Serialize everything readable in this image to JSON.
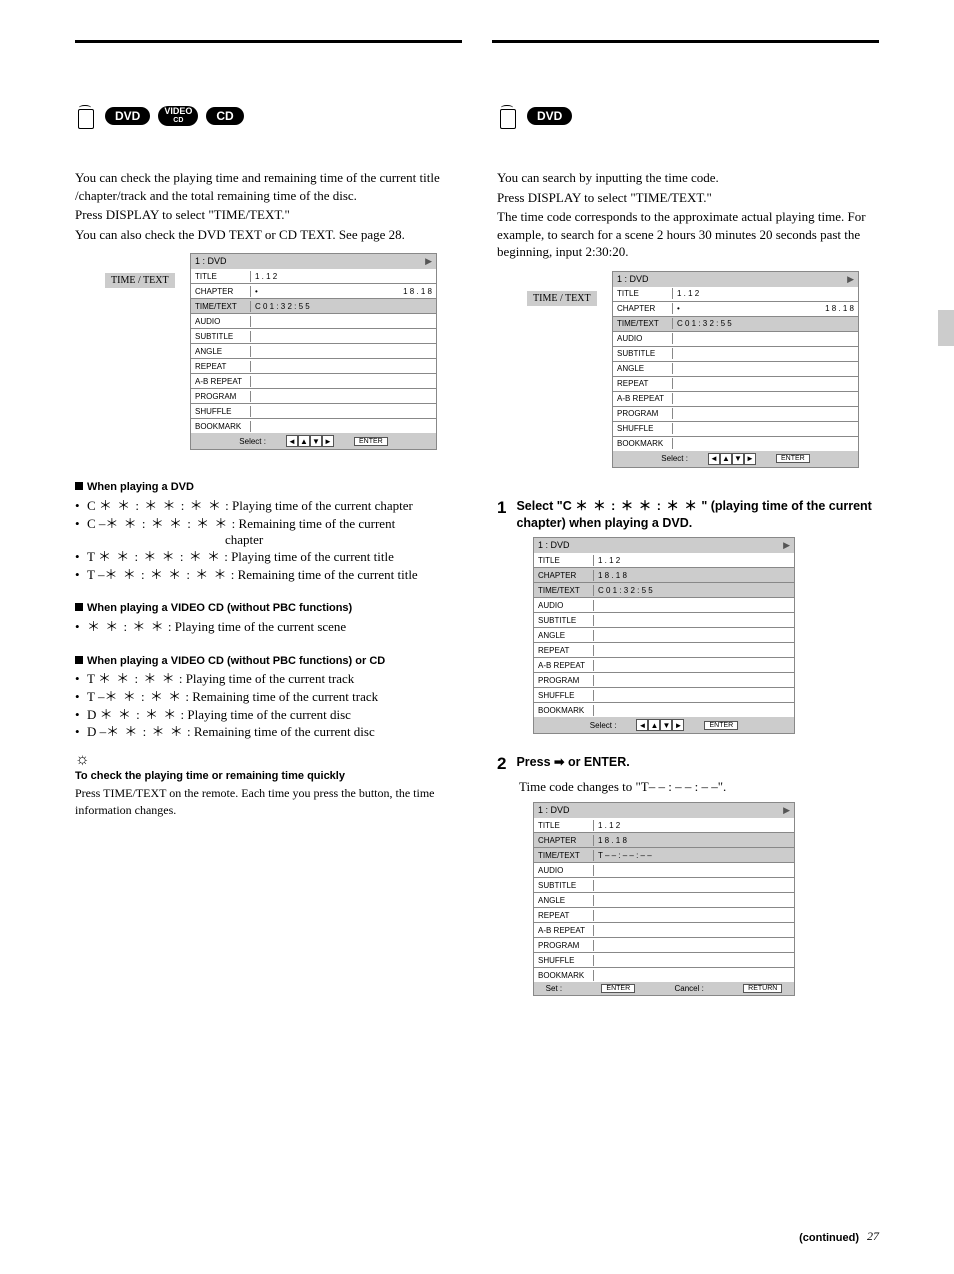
{
  "page_number": "27",
  "continued_text": "(continued)",
  "left": {
    "badges": [
      "DVD",
      "VIDEO CD",
      "CD"
    ],
    "intro": [
      "You can check the playing time and remaining time of the current title /chapter/track and the total remaining time of the disc.",
      "Press DISPLAY to select \"TIME/TEXT.\"",
      "You can also check the DVD TEXT or CD TEXT.  See page 28."
    ],
    "panel": {
      "title_tag": "TIME / TEXT",
      "head_left": "1 : DVD",
      "play_icon": "▶",
      "rows": [
        {
          "k": "TITLE",
          "v": "1 . 1 2"
        },
        {
          "k": "CHAPTER",
          "v": "1 8 . 1 8",
          "dot": true
        },
        {
          "k": "TIME/TEXT",
          "v": "C   0 1 : 3 2 : 5 5",
          "hl": true
        },
        {
          "k": "AUDIO",
          "v": ""
        },
        {
          "k": "SUBTITLE",
          "v": ""
        },
        {
          "k": "ANGLE",
          "v": ""
        },
        {
          "k": "REPEAT",
          "v": ""
        },
        {
          "k": "A-B REPEAT",
          "v": ""
        },
        {
          "k": "PROGRAM",
          "v": ""
        },
        {
          "k": "SHUFFLE",
          "v": ""
        },
        {
          "k": "BOOKMARK",
          "v": ""
        }
      ],
      "foot_select": "Select :",
      "foot_enter": "ENTER"
    },
    "sections": [
      {
        "heading": "When playing a DVD",
        "items": [
          {
            "pre": "C   ",
            "code": "＊ ＊ : ＊ ＊ : ＊ ＊",
            "post": " : Playing time of the current chapter"
          },
          {
            "pre": "C –",
            "code": "＊ ＊ : ＊ ＊ : ＊ ＊",
            "post": " : Remaining time of the current"
          },
          {
            "pre": "",
            "code": "",
            "post": "                             chapter",
            "indent": true
          },
          {
            "pre": "T   ",
            "code": "＊ ＊ : ＊ ＊ : ＊ ＊",
            "post": " : Playing time of the current title"
          },
          {
            "pre": "T –",
            "code": "＊ ＊ : ＊ ＊ : ＊ ＊",
            "post": " : Remaining time of the current title"
          }
        ]
      },
      {
        "heading": "When playing a VIDEO CD (without PBC functions)",
        "items": [
          {
            "pre": "",
            "code": "＊ ＊ : ＊ ＊",
            "post": " : Playing time of the current scene"
          }
        ]
      },
      {
        "heading": "When playing a VIDEO CD (without PBC functions) or CD",
        "items": [
          {
            "pre": "T   ",
            "code": "＊ ＊ : ＊ ＊",
            "post": " : Playing time of the current track"
          },
          {
            "pre": "T –",
            "code": "＊ ＊ : ＊ ＊",
            "post": " : Remaining time of the current track"
          },
          {
            "pre": "D  ",
            "code": "＊ ＊ : ＊ ＊",
            "post": " : Playing time of the current disc"
          },
          {
            "pre": "D –",
            "code": "＊ ＊ : ＊ ＊",
            "post": " : Remaining time of the current disc"
          }
        ]
      }
    ],
    "tip_heading": "To check the playing time or remaining time quickly",
    "tip_body": "Press TIME/TEXT on the remote.  Each time you press the button, the time information changes."
  },
  "right": {
    "badges": [
      "DVD"
    ],
    "intro": [
      "You can search by inputting the time code.",
      "Press DISPLAY to select \"TIME/TEXT.\"",
      "The time code corresponds to the approximate actual playing time. For example, to search for a scene 2 hours 30 minutes 20 seconds past the beginning, input 2:30:20."
    ],
    "panel": {
      "title_tag": "TIME / TEXT",
      "head_left": "1 : DVD",
      "play_icon": "▶",
      "rows": [
        {
          "k": "TITLE",
          "v": "1 . 1 2"
        },
        {
          "k": "CHAPTER",
          "v": "1 8 . 1 8",
          "dot": true
        },
        {
          "k": "TIME/TEXT",
          "v": "C   0 1 : 3 2 : 5 5",
          "hl": true
        },
        {
          "k": "AUDIO",
          "v": ""
        },
        {
          "k": "SUBTITLE",
          "v": ""
        },
        {
          "k": "ANGLE",
          "v": ""
        },
        {
          "k": "REPEAT",
          "v": ""
        },
        {
          "k": "A-B REPEAT",
          "v": ""
        },
        {
          "k": "PROGRAM",
          "v": ""
        },
        {
          "k": "SHUFFLE",
          "v": ""
        },
        {
          "k": "BOOKMARK",
          "v": ""
        }
      ],
      "foot_select": "Select :",
      "foot_enter": "ENTER"
    },
    "step1": {
      "num": "1",
      "text_a": "Select \"C ",
      "code": "＊ ＊ : ＊ ＊ : ＊ ＊",
      "text_b": " \" (playing time of the current chapter) when playing a DVD.",
      "panel": {
        "head_left": "1 : DVD",
        "play_icon": "▶",
        "rows": [
          {
            "k": "TITLE",
            "v": "1 . 1 2"
          },
          {
            "k": "CHAPTER",
            "v": "1 8 . 1 8",
            "hl": true
          },
          {
            "k": "TIME/TEXT",
            "v": "C   0 1 : 3 2 : 5 5",
            "hl": true
          },
          {
            "k": "AUDIO",
            "v": ""
          },
          {
            "k": "SUBTITLE",
            "v": ""
          },
          {
            "k": "ANGLE",
            "v": ""
          },
          {
            "k": "REPEAT",
            "v": ""
          },
          {
            "k": "A-B REPEAT",
            "v": ""
          },
          {
            "k": "PROGRAM",
            "v": ""
          },
          {
            "k": "SHUFFLE",
            "v": ""
          },
          {
            "k": "BOOKMARK",
            "v": ""
          }
        ],
        "foot_select": "Select :",
        "foot_enter": "ENTER"
      }
    },
    "step2": {
      "num": "2",
      "text": "Press ➡ or ENTER.",
      "sub": "Time code changes to \"T– – : – – : – –\".",
      "panel": {
        "head_left": "1 : DVD",
        "play_icon": "▶",
        "rows": [
          {
            "k": "TITLE",
            "v": "1 . 1 2"
          },
          {
            "k": "CHAPTER",
            "v": "1 8 . 1 8",
            "hl": true
          },
          {
            "k": "TIME/TEXT",
            "v": "T – – : – – : – –",
            "hl": true
          },
          {
            "k": "AUDIO",
            "v": ""
          },
          {
            "k": "SUBTITLE",
            "v": ""
          },
          {
            "k": "ANGLE",
            "v": ""
          },
          {
            "k": "REPEAT",
            "v": ""
          },
          {
            "k": "A-B REPEAT",
            "v": ""
          },
          {
            "k": "PROGRAM",
            "v": ""
          },
          {
            "k": "SHUFFLE",
            "v": ""
          },
          {
            "k": "BOOKMARK",
            "v": ""
          }
        ],
        "foot_set": "Set :",
        "foot_cancel": "Cancel :",
        "foot_return": "RETURN",
        "foot_enter": "ENTER"
      }
    }
  }
}
